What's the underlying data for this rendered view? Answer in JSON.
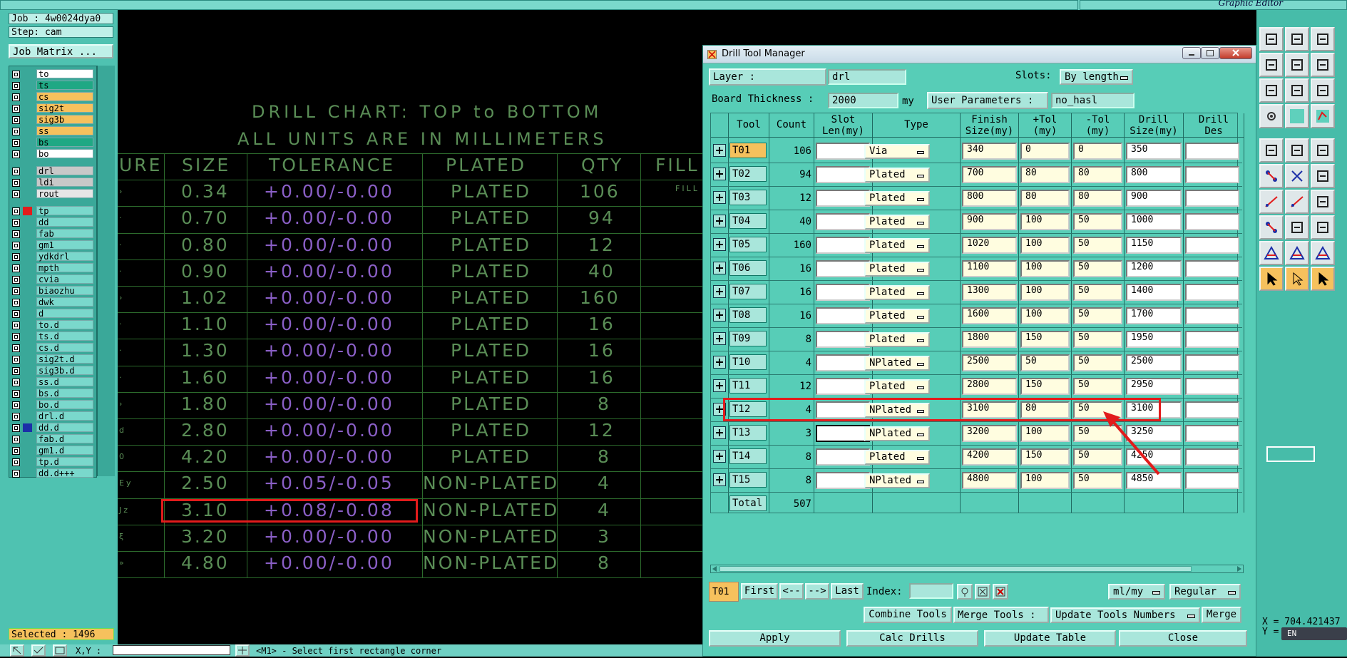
{
  "app": {
    "editor_title": "Graphic Editor"
  },
  "left_panel": {
    "job": "Job : 4w0024dya0",
    "step": "Step: cam",
    "job_matrix": "Job Matrix ...",
    "selected": "Selected : 1496",
    "layers": [
      {
        "name": "to",
        "color": "#ffffff"
      },
      {
        "name": "ts",
        "color": "#1fa884"
      },
      {
        "name": "cs",
        "color": "#f6c15d"
      },
      {
        "name": "sig2t",
        "color": "#f6c15d"
      },
      {
        "name": "sig3b",
        "color": "#f6c15d"
      },
      {
        "name": "ss",
        "color": "#f6c15d"
      },
      {
        "name": "bs",
        "color": "#1fa884"
      },
      {
        "name": "bo",
        "color": "#ffffff"
      },
      {
        "name": "drl",
        "color": "#c8c8c8",
        "gap": true
      },
      {
        "name": "ldi",
        "color": "#c8c8c8"
      },
      {
        "name": "rout",
        "color": "#e6e6e6"
      },
      {
        "name": "tp",
        "color": "#7ad8cc",
        "gap": true,
        "mark": "#e21c1c"
      },
      {
        "name": "dd",
        "color": "#7ad8cc"
      },
      {
        "name": "fab",
        "color": "#7ad8cc"
      },
      {
        "name": "gm1",
        "color": "#7ad8cc"
      },
      {
        "name": "ydkdrl",
        "color": "#7ad8cc"
      },
      {
        "name": "mpth",
        "color": "#7ad8cc"
      },
      {
        "name": "cvia",
        "color": "#7ad8cc"
      },
      {
        "name": "biaozhu",
        "color": "#7ad8cc"
      },
      {
        "name": "dwk",
        "color": "#7ad8cc"
      },
      {
        "name": "d",
        "color": "#7ad8cc"
      },
      {
        "name": "to.d",
        "color": "#7ad8cc"
      },
      {
        "name": "ts.d",
        "color": "#7ad8cc"
      },
      {
        "name": "cs.d",
        "color": "#7ad8cc"
      },
      {
        "name": "sig2t.d",
        "color": "#7ad8cc"
      },
      {
        "name": "sig3b.d",
        "color": "#7ad8cc"
      },
      {
        "name": "ss.d",
        "color": "#7ad8cc"
      },
      {
        "name": "bs.d",
        "color": "#7ad8cc"
      },
      {
        "name": "bo.d",
        "color": "#7ad8cc"
      },
      {
        "name": "drl.d",
        "color": "#7ad8cc"
      },
      {
        "name": "dd.d",
        "color": "#7ad8cc",
        "mark": "#1b2fa8"
      },
      {
        "name": "fab.d",
        "color": "#7ad8cc"
      },
      {
        "name": "gm1.d",
        "color": "#7ad8cc"
      },
      {
        "name": "tp.d",
        "color": "#7ad8cc"
      },
      {
        "name": "dd.d+++",
        "color": "#7ad8cc"
      }
    ]
  },
  "drill_chart": {
    "title1": "DRILL CHART: TOP to BOTTOM",
    "title2": "ALL UNITS ARE IN MILLIMETERS",
    "headers": [
      "URE",
      "SIZE",
      "TOLERANCE",
      "PLATED",
      "QTY",
      "FILL"
    ],
    "fill_note": "FILL",
    "rows": [
      {
        "sym": "›",
        "size": "0.34",
        "tol": "+0.00/-0.00",
        "plated": "PLATED",
        "qty": "106"
      },
      {
        "sym": "·",
        "size": "0.70",
        "tol": "+0.00/-0.00",
        "plated": "PLATED",
        "qty": "94"
      },
      {
        "sym": "·",
        "size": "0.80",
        "tol": "+0.00/-0.00",
        "plated": "PLATED",
        "qty": "12"
      },
      {
        "sym": "·",
        "size": "0.90",
        "tol": "+0.00/-0.00",
        "plated": "PLATED",
        "qty": "40"
      },
      {
        "sym": "›",
        "size": "1.02",
        "tol": "+0.00/-0.00",
        "plated": "PLATED",
        "qty": "160"
      },
      {
        "sym": "·",
        "size": "1.10",
        "tol": "+0.00/-0.00",
        "plated": "PLATED",
        "qty": "16"
      },
      {
        "sym": "·",
        "size": "1.30",
        "tol": "+0.00/-0.00",
        "plated": "PLATED",
        "qty": "16"
      },
      {
        "sym": "·",
        "size": "1.60",
        "tol": "+0.00/-0.00",
        "plated": "PLATED",
        "qty": "16"
      },
      {
        "sym": "›",
        "size": "1.80",
        "tol": "+0.00/-0.00",
        "plated": "PLATED",
        "qty": "8"
      },
      {
        "sym": "d",
        "size": "2.80",
        "tol": "+0.00/-0.00",
        "plated": "PLATED",
        "qty": "12"
      },
      {
        "sym": "0",
        "size": "4.20",
        "tol": "+0.00/-0.00",
        "plated": "PLATED",
        "qty": "8"
      },
      {
        "sym": "Ey",
        "size": "2.50",
        "tol": "+0.05/-0.05",
        "plated": "NON-PLATED",
        "qty": "4"
      },
      {
        "sym": "Jz",
        "size": "3.10",
        "tol": "+0.08/-0.08",
        "plated": "NON-PLATED",
        "qty": "4"
      },
      {
        "sym": "ξ",
        "size": "3.20",
        "tol": "+0.00/-0.00",
        "plated": "NON-PLATED",
        "qty": "3"
      },
      {
        "sym": "»",
        "size": "4.80",
        "tol": "+0.00/-0.00",
        "plated": "NON-PLATED",
        "qty": "8"
      }
    ]
  },
  "dialog": {
    "title": "Drill Tool Manager",
    "layer_label": "Layer           :",
    "layer_value": "drl",
    "slots_label": "Slots:",
    "slots_value": "By length",
    "board_thickness_label": "Board Thickness :",
    "board_thickness_value": "2000",
    "board_thickness_unit": "my",
    "user_params_label": "User Parameters :",
    "user_params_value": "no_hasl",
    "columns": [
      "Tool",
      "Count",
      "Slot\nLen(my)",
      "Type",
      "Finish\nSize(my)",
      "+Tol\n(my)",
      "-Tol\n(my)",
      "Drill\nSize(my)",
      "Drill\nDes"
    ],
    "tools": [
      {
        "tool": "T01",
        "count": "106",
        "type": "Via",
        "finish": "340",
        "ptol": "0",
        "mtol": "0",
        "drill": "350"
      },
      {
        "tool": "T02",
        "count": "94",
        "type": "Plated",
        "finish": "700",
        "ptol": "80",
        "mtol": "80",
        "drill": "800"
      },
      {
        "tool": "T03",
        "count": "12",
        "type": "Plated",
        "finish": "800",
        "ptol": "80",
        "mtol": "80",
        "drill": "900"
      },
      {
        "tool": "T04",
        "count": "40",
        "type": "Plated",
        "finish": "900",
        "ptol": "100",
        "mtol": "50",
        "drill": "1000"
      },
      {
        "tool": "T05",
        "count": "160",
        "type": "Plated",
        "finish": "1020",
        "ptol": "100",
        "mtol": "50",
        "drill": "1150"
      },
      {
        "tool": "T06",
        "count": "16",
        "type": "Plated",
        "finish": "1100",
        "ptol": "100",
        "mtol": "50",
        "drill": "1200"
      },
      {
        "tool": "T07",
        "count": "16",
        "type": "Plated",
        "finish": "1300",
        "ptol": "100",
        "mtol": "50",
        "drill": "1400"
      },
      {
        "tool": "T08",
        "count": "16",
        "type": "Plated",
        "finish": "1600",
        "ptol": "100",
        "mtol": "50",
        "drill": "1700"
      },
      {
        "tool": "T09",
        "count": "8",
        "type": "Plated",
        "finish": "1800",
        "ptol": "150",
        "mtol": "50",
        "drill": "1950"
      },
      {
        "tool": "T10",
        "count": "4",
        "type": "NPlated",
        "finish": "2500",
        "ptol": "50",
        "mtol": "50",
        "drill": "2500"
      },
      {
        "tool": "T11",
        "count": "12",
        "type": "Plated",
        "finish": "2800",
        "ptol": "150",
        "mtol": "50",
        "drill": "2950"
      },
      {
        "tool": "T12",
        "count": "4",
        "type": "NPlated",
        "finish": "3100",
        "ptol": "80",
        "mtol": "50",
        "drill": "3100"
      },
      {
        "tool": "T13",
        "count": "3",
        "type": "NPlated",
        "finish": "3200",
        "ptol": "100",
        "mtol": "50",
        "drill": "3250"
      },
      {
        "tool": "T14",
        "count": "8",
        "type": "Plated",
        "finish": "4200",
        "ptol": "150",
        "mtol": "50",
        "drill": "4250"
      },
      {
        "tool": "T15",
        "count": "8",
        "type": "NPlated",
        "finish": "4800",
        "ptol": "100",
        "mtol": "50",
        "drill": "4850"
      }
    ],
    "total_label": "Total",
    "total_count": "507",
    "nav": {
      "current": "T01",
      "first": "First",
      "prev": "<--",
      "next": "-->",
      "last": "Last",
      "index_label": "Index:"
    },
    "units_value": "ml/my",
    "mode_value": "Regular",
    "combine_tools": "Combine Tools",
    "merge_tools_label": "Merge Tools :",
    "update_tools_numbers": "Update Tools Numbers",
    "merge": "Merge",
    "apply": "Apply",
    "calc_drills": "Calc Drills",
    "update_table": "Update Table",
    "close": "Close"
  },
  "status": {
    "xy_label": "X,Y :",
    "message": "<M1> - Select first rectangle corner",
    "coord_x": "X = 704.421437",
    "coord_y": "Y =",
    "lang": "EN"
  },
  "colors": {
    "accent_red": "#e21c1c",
    "panel": "#57cdb7",
    "highlight": "#f6c15d"
  }
}
